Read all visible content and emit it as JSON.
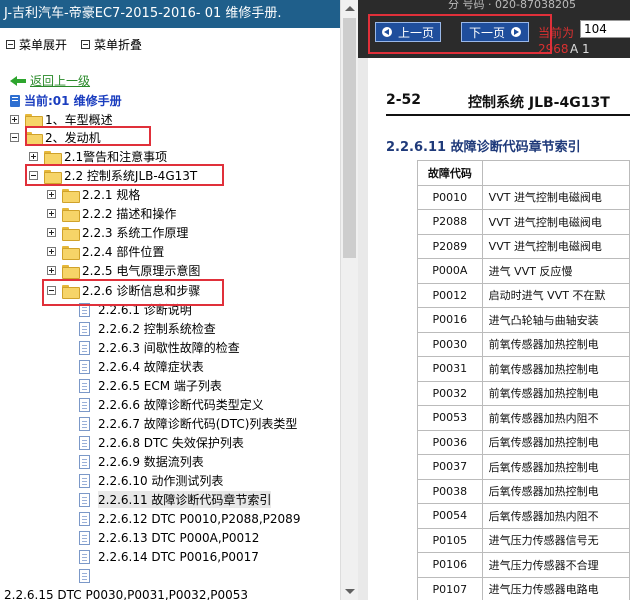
{
  "left": {
    "title": "J-吉利汽车-帝豪EC7-2015-2016- 01 维修手册.",
    "menu": [
      {
        "label": "菜单展开"
      },
      {
        "label": "菜单折叠"
      }
    ],
    "back_label": "返回上一级",
    "current_label": "当前:01 维修手册",
    "tree": [
      {
        "label": "1、车型概述"
      },
      {
        "label": "2、发动机"
      },
      {
        "label": "2.1警告和注意事项"
      },
      {
        "label": "2.2 控制系统JLB-4G13T"
      },
      {
        "label": "2.2.1 规格"
      },
      {
        "label": "2.2.2 描述和操作"
      },
      {
        "label": "2.2.3 系统工作原理"
      },
      {
        "label": "2.2.4 部件位置"
      },
      {
        "label": "2.2.5 电气原理示意图"
      },
      {
        "label": "2.2.6 诊断信息和步骤"
      },
      {
        "label": "2.2.6.1 诊断说明"
      },
      {
        "label": "2.2.6.2 控制系统检查"
      },
      {
        "label": "2.2.6.3 间歇性故障的检查"
      },
      {
        "label": "2.2.6.4 故障症状表"
      },
      {
        "label": "2.2.6.5 ECM 端子列表"
      },
      {
        "label": "2.2.6.6 故障诊断代码类型定义"
      },
      {
        "label": "2.2.6.7 故障诊断代码(DTC)列表类型"
      },
      {
        "label": "2.2.6.8 DTC 失效保护列表"
      },
      {
        "label": "2.2.6.9 数据流列表"
      },
      {
        "label": "2.2.6.10 动作测试列表"
      },
      {
        "label": "2.2.6.11 故障诊断代码章节索引"
      },
      {
        "label": "2.2.6.12 DTC P0010,P2088,P2089"
      },
      {
        "label": "2.2.6.13 DTC P000A,P0012"
      },
      {
        "label": "2.2.6.14 DTC P0016,P0017"
      },
      {
        "label": "2.2.6.15 DTC P0030,P0031,P0032,P0053"
      }
    ]
  },
  "right": {
    "top_meta": "分 号码 · 020-87038205",
    "prev_label": "上一页",
    "next_label": "下一页",
    "current_page_label": "当前为",
    "current_page_value": "104",
    "total_pages": "2968",
    "total_tail": "A 1",
    "page_number": "2-52",
    "page_header": "控制系统 JLB-4G13T",
    "section_title": "2.2.6.11 故障诊断代码章节索引",
    "table": {
      "header": [
        "故障代码",
        ""
      ],
      "rows": [
        [
          "P0010",
          "VVT 进气控制电磁阀电"
        ],
        [
          "P2088",
          "VVT 进气控制电磁阀电"
        ],
        [
          "P2089",
          "VVT 进气控制电磁阀电"
        ],
        [
          "P000A",
          "进气 VVT 反应慢"
        ],
        [
          "P0012",
          "启动时进气 VVT 不在默"
        ],
        [
          "P0016",
          "进气凸轮轴与曲轴安装"
        ],
        [
          "P0030",
          "前氧传感器加热控制电"
        ],
        [
          "P0031",
          "前氧传感器加热控制电"
        ],
        [
          "P0032",
          "前氧传感器加热控制电"
        ],
        [
          "P0053",
          "前氧传感器加热内阻不"
        ],
        [
          "P0036",
          "后氧传感器加热控制电"
        ],
        [
          "P0037",
          "后氧传感器加热控制电"
        ],
        [
          "P0038",
          "后氧传感器加热控制电"
        ],
        [
          "P0054",
          "后氧传感器加热内阻不"
        ],
        [
          "P0105",
          "进气压力传感器信号无"
        ],
        [
          "P0106",
          "进气压力传感器不合理"
        ],
        [
          "P0107",
          "进气压力传感器电路电"
        ]
      ]
    }
  }
}
